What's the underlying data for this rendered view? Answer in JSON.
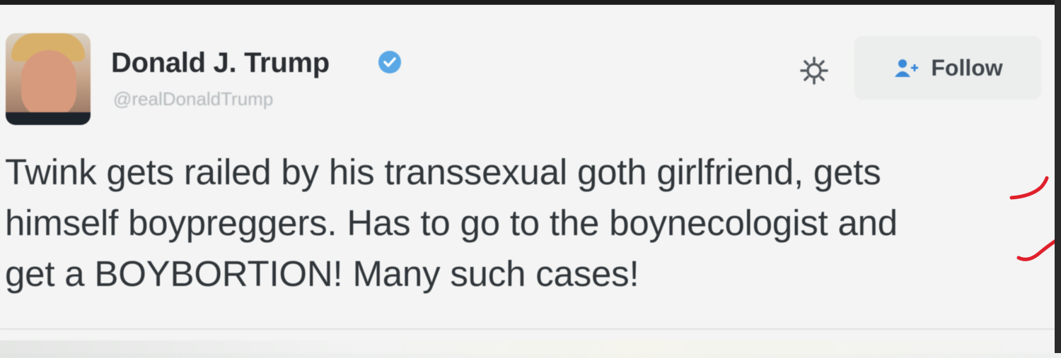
{
  "tweet": {
    "author_name": "Donald J. Trump",
    "author_handle": "@realDonaldTrump",
    "text_lines": [
      "Twink gets railed by his transsexual goth girlfriend, gets",
      "himself boypreggers. Has to go to the boynecologist and",
      "get a BOYBORTION! Many such cases!"
    ]
  },
  "actions": {
    "follow_label": "Follow"
  },
  "icons": {
    "verified": "verified-badge-icon",
    "settings": "gear-icon",
    "follow": "add-person-icon"
  },
  "colors": {
    "verified_blue": "#5aa7e6",
    "annotation_red": "#e0202c",
    "text": "#31363b"
  }
}
